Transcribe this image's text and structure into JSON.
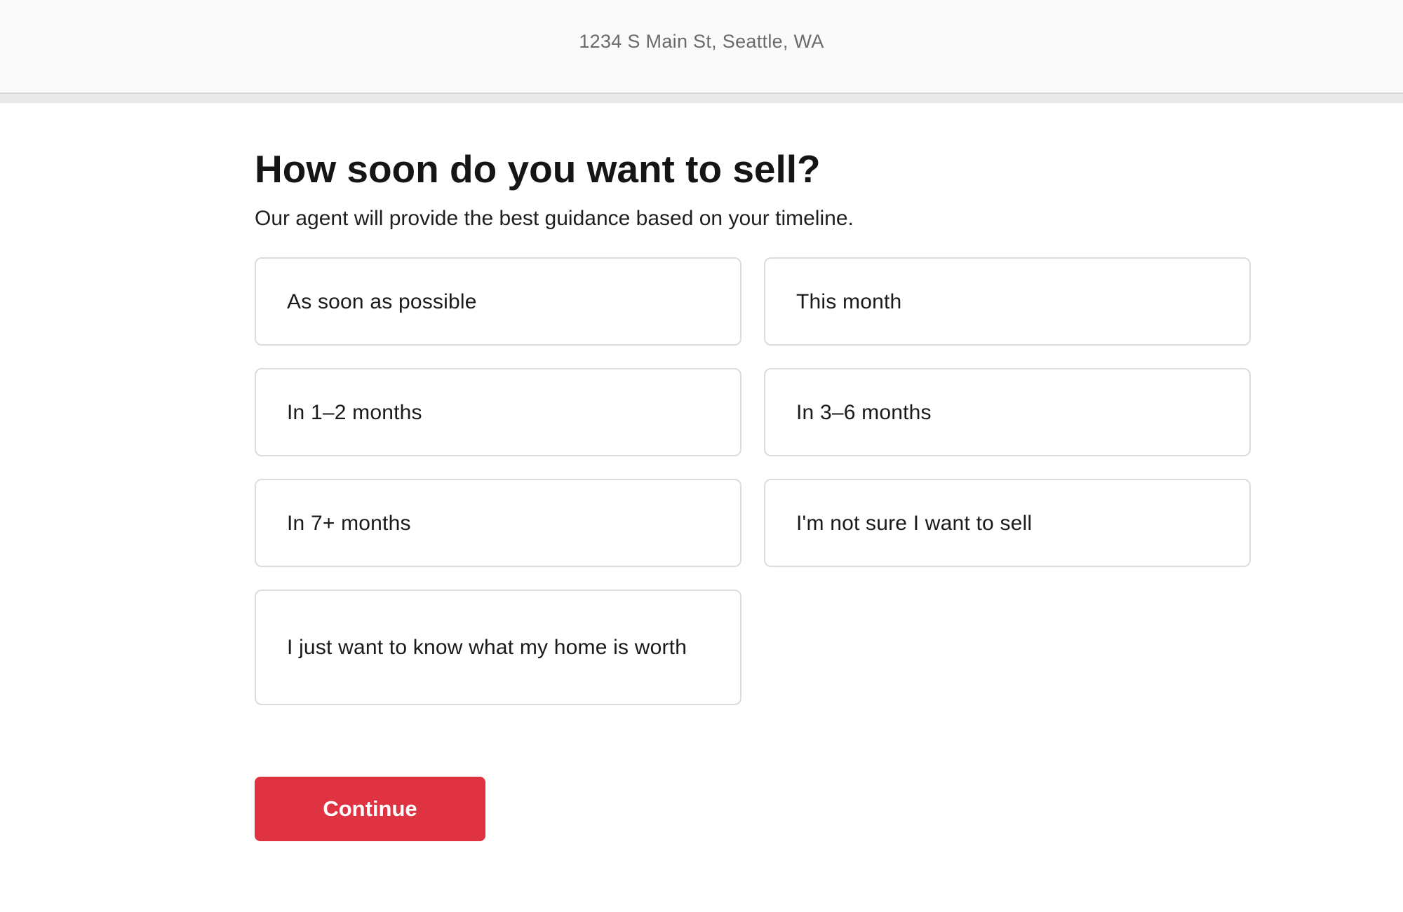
{
  "header": {
    "address": "1234 S Main St, Seattle, WA"
  },
  "progress": {
    "fraction": 0
  },
  "question": {
    "title": "How soon do you want to sell?",
    "subtitle": "Our agent will provide the best guidance based on your timeline."
  },
  "options": [
    {
      "label": "As soon as possible"
    },
    {
      "label": "This month"
    },
    {
      "label": "In 1–2 months"
    },
    {
      "label": "In 3–6 months"
    },
    {
      "label": "In 7+ months"
    },
    {
      "label": "I'm not sure I want to sell"
    },
    {
      "label": "I just want to know what my home is worth"
    }
  ],
  "actions": {
    "continue_label": "Continue"
  },
  "colors": {
    "accent": "#e03341",
    "border": "#dcdcdc",
    "header_bg": "#fafafa"
  }
}
